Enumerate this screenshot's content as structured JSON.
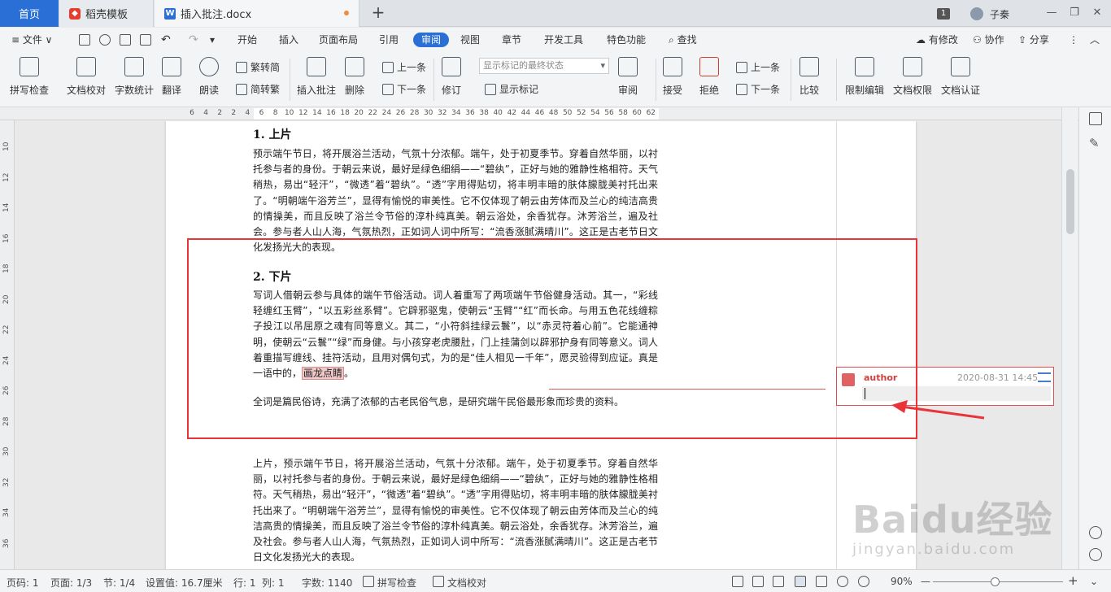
{
  "tabs": {
    "home": "首页",
    "template": "稻壳模板",
    "doc": "插入批注.docx",
    "add": "+"
  },
  "window": {
    "badge": "1",
    "user": "子秦",
    "min": "—",
    "restore": "❐",
    "close": "✕"
  },
  "menu": {
    "file": "≡ 文件 ∨",
    "items": [
      "开始",
      "插入",
      "页面布局",
      "引用",
      "审阅",
      "视图",
      "章节",
      "开发工具",
      "特色功能"
    ],
    "search": "查找",
    "right": [
      "有修改",
      "协作",
      "分享"
    ]
  },
  "ribbon": {
    "spellcheck": "拼写检查",
    "proofread": "文档校对",
    "wordcount": "字数统计",
    "translate": "翻译",
    "read": "朗读",
    "trad": "繁转简",
    "simp": "简转繁",
    "insert_comment": "插入批注",
    "delete": "删除",
    "prev": "上一条",
    "next": "下一条",
    "revise": "修订",
    "markup_select": "显示标记的最终状态",
    "show_markup": "显示标记",
    "review": "审阅",
    "accept": "接受",
    "reject": "拒绝",
    "prev2": "上一条",
    "next2": "下一条",
    "compare": "比较",
    "restrict": "限制编辑",
    "permission": "文档权限",
    "certify": "文档认证"
  },
  "ruler": {
    "h_ticks": [
      "6",
      "4",
      "2",
      "2",
      "4",
      "6",
      "8",
      "10",
      "12",
      "14",
      "16",
      "18",
      "20",
      "22",
      "24",
      "26",
      "28",
      "30",
      "32",
      "34",
      "36",
      "38",
      "40",
      "42",
      "44",
      "46",
      "48",
      "50",
      "52",
      "54",
      "56",
      "58",
      "60",
      "62"
    ],
    "v_ticks": [
      "10",
      "12",
      "14",
      "16",
      "18",
      "20",
      "22",
      "24",
      "26",
      "28",
      "30",
      "32",
      "34",
      "36"
    ]
  },
  "document": {
    "h1": "1. 上片",
    "p1": "预示端午节日，将开展浴兰活动，气氛十分浓郁。端午，处于初夏季节。穿着自然华丽，以衬托参与者的身份。于朝云来说，最好是绿色细绢——“碧纨”，正好与她的雅静性格相符。天气稍热，易出“轻汗”，“微透”着“碧纨”。“透”字用得贴切，将丰明丰暗的肤体朦胧美衬托出来了。“明朝端午浴芳兰”，显得有愉悦的审美性。它不仅体现了朝云由芳体而及兰心的纯洁高贵的情操美，而且反映了浴兰令节俗的淳朴纯真美。朝云浴处，余香犹存。沐芳浴兰，遍及社会。参与者人山人海，气氛热烈，正如词人词中所写：“流香涨腻满晴川”。这正是古老节日文化发扬光大的表现。",
    "h2": "2. 下片",
    "p2": "写词人借朝云参与具体的端午节俗活动。词人着重写了两项端午节俗健身活动。其一，“彩线轻缠红玉臂”，“以五彩丝系臂”。它辟邪驱鬼，使朝云“玉臂”“红”而长命。与用五色花线缠粽子投江以吊屈原之魂有同等意义。其二，“小符斜挂绿云鬟”，以“赤灵符着心前”。它能通神明，使朝云“云鬟”“绿”而身健。与小孩穿老虎腰肚，门上挂蒲剑以辟邪护身有同等意义。词人着重描写缠线、挂符活动，且用对偶句式，为的是“佳人相见一千年”，愿灵验得到应证。真是一语中的，",
    "p2_hl": "画龙点睛",
    "p2_end": "。",
    "p3": "全词是篇民俗诗，充满了浓郁的古老民俗气息，是研究端午民俗最形象而珍贵的资料。",
    "p4": "上片，预示端午节日，将开展浴兰活动，气氛十分浓郁。端午，处于初夏季节。穿着自然华丽，以衬托参与者的身份。于朝云来说，最好是绿色细绢——“碧纨”，正好与她的雅静性格相符。天气稍热，易出“轻汗”，“微透”着“碧纨”。“透”字用得贴切，将丰明丰暗的肤体朦胧美衬托出来了。“明朝端午浴芳兰”，显得有愉悦的审美性。它不仅体现了朝云由芳体而及兰心的纯洁高贵的情操美，而且反映了浴兰令节俗的淳朴纯真美。朝云浴处，余香犹存。沐芳浴兰，遍及社会。参与者人山人海，气氛热烈，正如词人词中所写：“流香涨腻满晴川”。这正是古老节日文化发扬光大的表现。"
  },
  "comment": {
    "author": "author",
    "date": "2020-08-31 14:45"
  },
  "status": {
    "page_no": "页码: 1",
    "page": "页面: 1/3",
    "section": "节: 1/4",
    "setting": "设置值: 16.7厘米",
    "row": "行: 1",
    "col": "列: 1",
    "words": "字数: 1140",
    "spell": "拼写检查",
    "proof": "文档校对",
    "zoom": "90%",
    "zoom_minus": "—",
    "zoom_plus": "+"
  },
  "watermark": {
    "brand": "Baidu经验",
    "url": "jingyan.baidu.com"
  },
  "colors": {
    "accent": "#2a6fd6",
    "annotation": "#e8353a",
    "comment_border": "#e04d4d"
  }
}
